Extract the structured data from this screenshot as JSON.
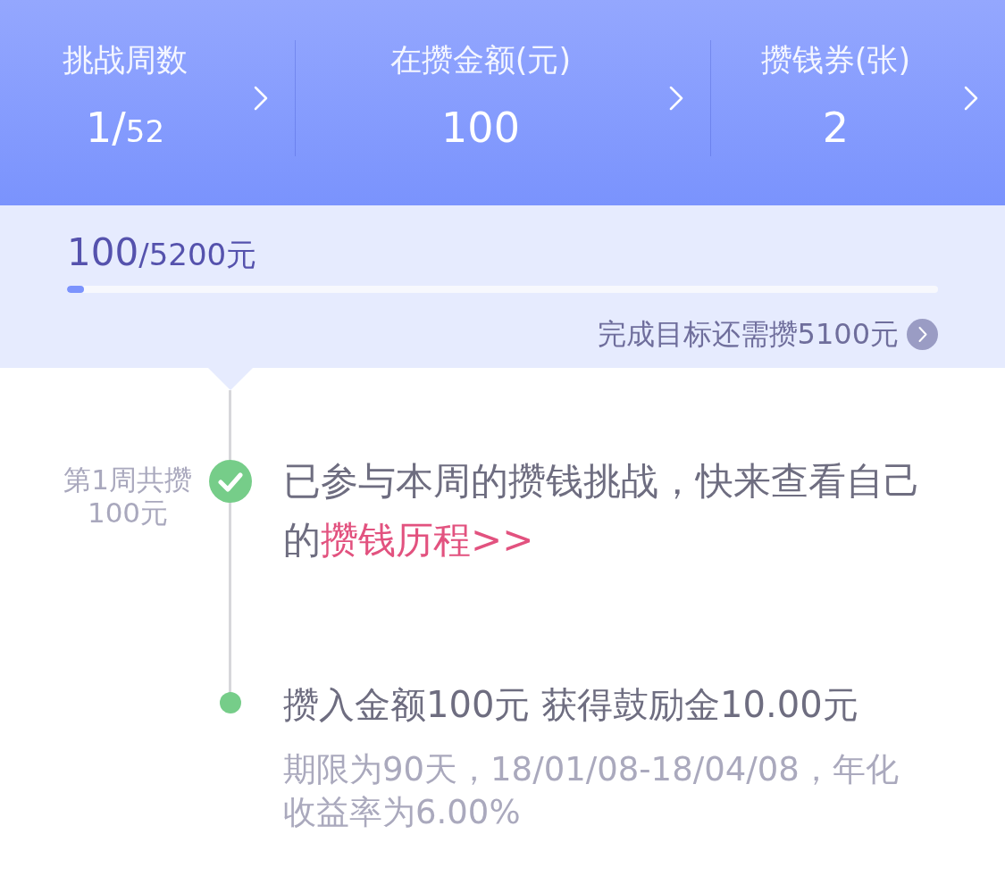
{
  "stats": [
    {
      "label": "挑战周数",
      "value": "1/",
      "value_tail": "52"
    },
    {
      "label": "在攒金额(元)",
      "value": "100"
    },
    {
      "label": "攒钱券(张)",
      "value": "2"
    }
  ],
  "progress": {
    "amount": "100",
    "amount_tail": "/5200元",
    "level": 0.019,
    "remaining": "完成目标还需攒5100元"
  },
  "timeline": [
    {
      "kind": "check",
      "side_label": "第1周共攒100元",
      "message": "已参与本周的攒钱挑战，快来查看自己的",
      "link": "攒钱历程>>"
    },
    {
      "kind": "dot",
      "title": "攒入金额100元 获得鼓励金10.00元",
      "detail": "期限为90天，18/01/08-18/04/08，年化收益率为6.00%"
    }
  ]
}
